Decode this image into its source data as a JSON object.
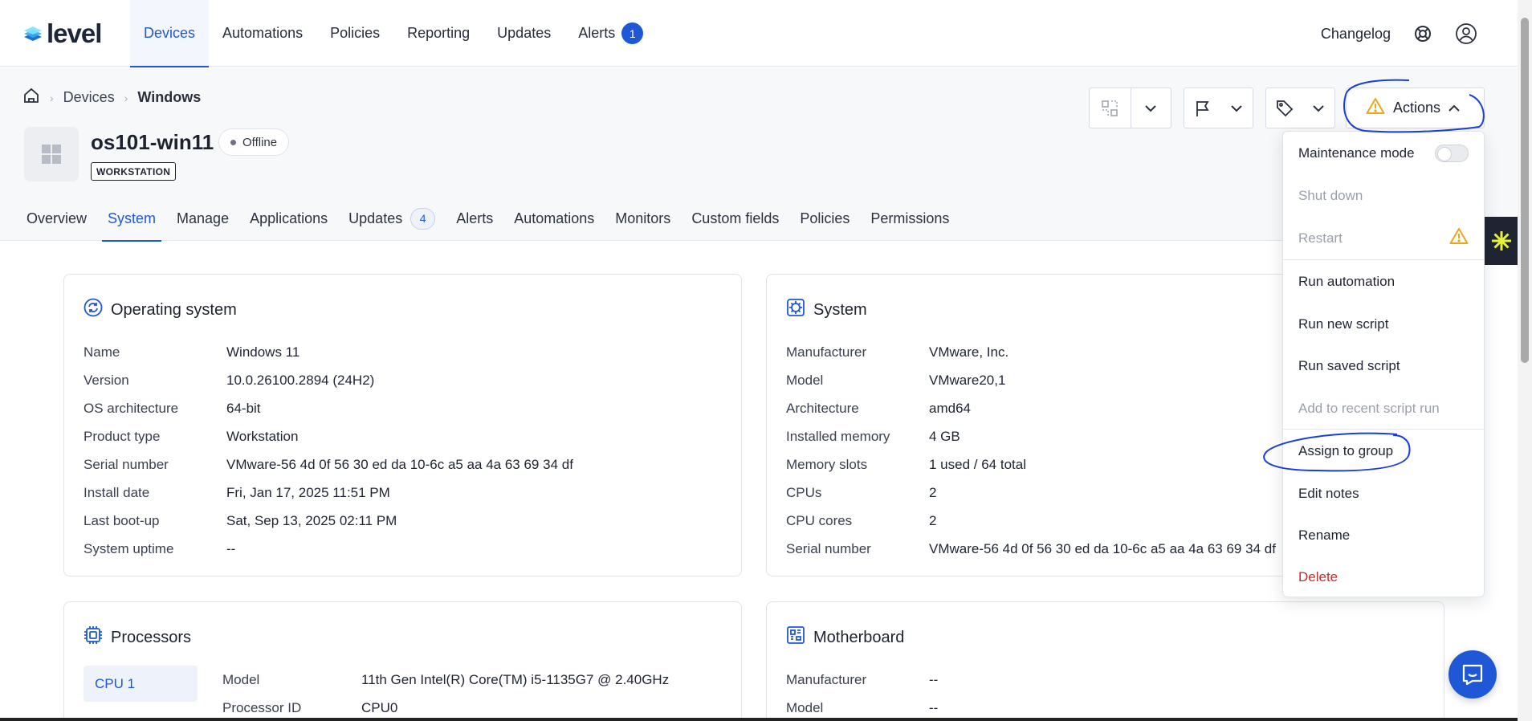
{
  "app": {
    "logo_text": "level"
  },
  "nav": {
    "items": [
      {
        "label": "Devices",
        "active": true
      },
      {
        "label": "Automations"
      },
      {
        "label": "Policies"
      },
      {
        "label": "Reporting"
      },
      {
        "label": "Updates"
      },
      {
        "label": "Alerts",
        "badge": "1"
      }
    ],
    "changelog": "Changelog",
    "icons": [
      "lifebuoy-icon",
      "user-avatar-icon"
    ]
  },
  "breadcrumb": {
    "home_icon": "home-icon",
    "items": [
      "Devices",
      "Windows"
    ]
  },
  "device": {
    "name": "os101-win11",
    "status": "Offline",
    "type": "WORKSTATION",
    "os_icon": "windows-icon"
  },
  "toolbar": {
    "actions_label": "Actions",
    "icons": [
      "group-icon",
      "flag-icon",
      "tag-icon",
      "warning-icon"
    ]
  },
  "tabs": [
    {
      "label": "Overview"
    },
    {
      "label": "System",
      "active": true
    },
    {
      "label": "Manage"
    },
    {
      "label": "Applications"
    },
    {
      "label": "Updates",
      "badge": "4"
    },
    {
      "label": "Alerts"
    },
    {
      "label": "Automations"
    },
    {
      "label": "Monitors"
    },
    {
      "label": "Custom fields"
    },
    {
      "label": "Policies"
    },
    {
      "label": "Permissions"
    }
  ],
  "os_card": {
    "title": "Operating system",
    "rows": [
      {
        "k": "Name",
        "v": "Windows 11"
      },
      {
        "k": "Version",
        "v": "10.0.26100.2894 (24H2)"
      },
      {
        "k": "OS architecture",
        "v": "64-bit"
      },
      {
        "k": "Product type",
        "v": "Workstation"
      },
      {
        "k": "Serial number",
        "v": "VMware-56 4d 0f 56 30 ed da 10-6c a5 aa 4a 63 69 34 df"
      },
      {
        "k": "Install date",
        "v": "Fri, Jan 17, 2025 11:51 PM"
      },
      {
        "k": "Last boot-up",
        "v": "Sat, Sep 13, 2025 02:11 PM"
      },
      {
        "k": "System uptime",
        "v": "--"
      }
    ]
  },
  "system_card": {
    "title": "System",
    "rows": [
      {
        "k": "Manufacturer",
        "v": "VMware, Inc."
      },
      {
        "k": "Model",
        "v": "VMware20,1"
      },
      {
        "k": "Architecture",
        "v": "amd64"
      },
      {
        "k": "Installed memory",
        "v": "4 GB"
      },
      {
        "k": "Memory slots",
        "v": "1 used / 64 total"
      },
      {
        "k": "CPUs",
        "v": "2"
      },
      {
        "k": "CPU cores",
        "v": "2"
      },
      {
        "k": "Serial number",
        "v": "VMware-56 4d 0f 56 30 ed da 10-6c a5 aa 4a 63 69 34 df"
      }
    ]
  },
  "processors_card": {
    "title": "Processors",
    "cpu_tab": "CPU 1",
    "rows": [
      {
        "k": "Model",
        "v": "11th Gen Intel(R) Core(TM) i5-1135G7 @ 2.40GHz"
      },
      {
        "k": "Processor ID",
        "v": "CPU0"
      }
    ]
  },
  "motherboard_card": {
    "title": "Motherboard",
    "rows": [
      {
        "k": "Manufacturer",
        "v": "--"
      },
      {
        "k": "Model",
        "v": "--"
      }
    ]
  },
  "actions_menu": {
    "items": [
      {
        "label": "Maintenance mode",
        "kind": "toggle"
      },
      {
        "label": "Shut down",
        "disabled": true
      },
      {
        "label": "Restart",
        "disabled": true,
        "icon": "warning-icon"
      },
      {
        "label": "Run automation"
      },
      {
        "label": "Run new script"
      },
      {
        "label": "Run saved script"
      },
      {
        "label": "Add to recent script run",
        "disabled": true
      },
      {
        "label": "Assign to group"
      },
      {
        "label": "Edit notes"
      },
      {
        "label": "Rename"
      },
      {
        "label": "Delete",
        "danger": true
      }
    ]
  },
  "colors": {
    "accent": "#1f58d6",
    "danger": "#c42b2b",
    "warning": "#f0b429",
    "annotation": "#1a3fd6"
  }
}
